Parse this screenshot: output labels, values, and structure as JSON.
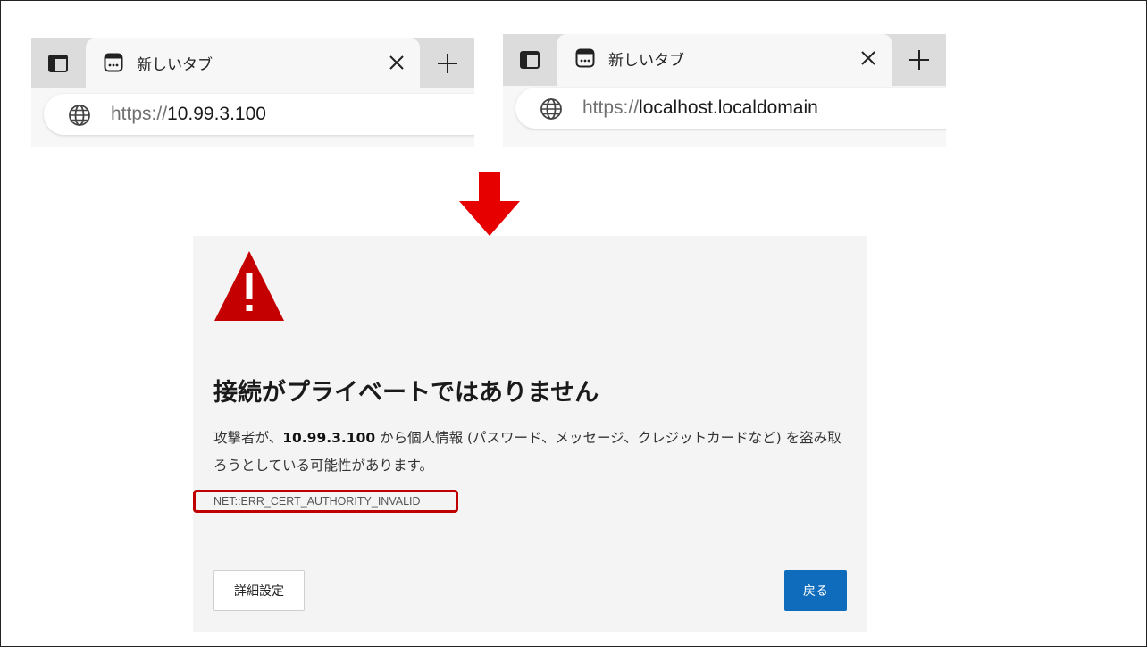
{
  "browsers": [
    {
      "tab_title": "新しいタブ",
      "url_scheme": "https://",
      "url_host": "10.99.3.100"
    },
    {
      "tab_title": "新しいタブ",
      "url_scheme": "https://",
      "url_host": "localhost.localdomain"
    }
  ],
  "error_page": {
    "title": "接続がプライベートではありません",
    "body_prefix": "攻撃者が、",
    "body_host": "10.99.3.100",
    "body_suffix": " から個人情報 (パスワード、メッセージ、クレジットカードなど) を盗み取ろうとしている可能性があります。",
    "error_code": "NET::ERR_CERT_AUTHORITY_INVALID",
    "advanced_label": "詳細設定",
    "back_label": "戻る"
  },
  "colors": {
    "highlight_red": "#c00000",
    "arrow_red": "#e60000",
    "warning_red": "#c40000",
    "primary_button": "#0f6cbd"
  },
  "icons": {
    "tab_actions": "sidebar-panel-icon",
    "favicon": "new-tab-page-icon",
    "close": "close-icon",
    "new_tab": "plus-icon",
    "address": "globe-icon",
    "warning": "warning-triangle-icon",
    "arrow": "arrow-down-icon"
  }
}
